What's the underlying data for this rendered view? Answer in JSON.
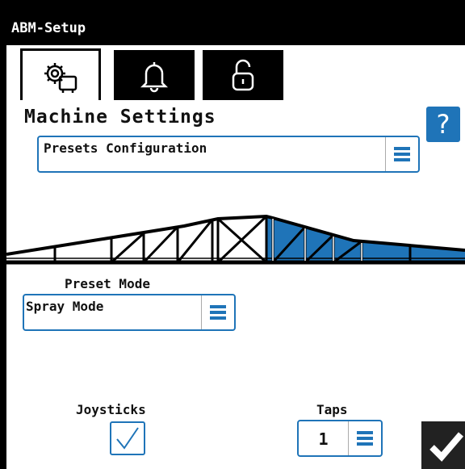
{
  "window": {
    "title": "ABM-Setup"
  },
  "tabs": [
    {
      "icon": "machine-settings-icon",
      "active": true
    },
    {
      "icon": "bell-icon",
      "active": false
    },
    {
      "icon": "lock-icon",
      "active": false
    }
  ],
  "main": {
    "title": "Machine Settings",
    "help_label": "?",
    "presets_dropdown": {
      "value": "Presets Configuration"
    },
    "preset_mode": {
      "label": "Preset Mode",
      "value": "Spray Mode"
    },
    "joysticks": {
      "label": "Joysticks",
      "checked": true
    },
    "taps": {
      "label": "Taps",
      "value": "1"
    }
  },
  "colors": {
    "accent": "#1f74b8",
    "boom_active": "#1f74b8",
    "titlebar": "#000000"
  }
}
